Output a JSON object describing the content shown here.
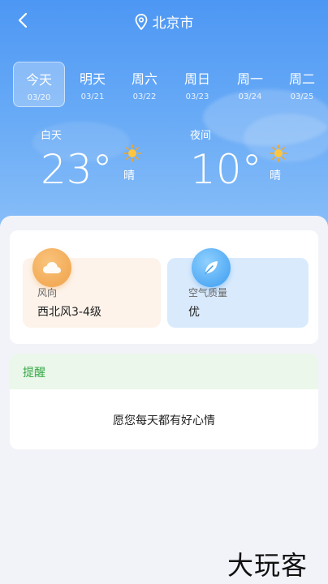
{
  "header": {
    "city": "北京市"
  },
  "days": [
    {
      "name": "今天",
      "date": "03/20"
    },
    {
      "name": "明天",
      "date": "03/21"
    },
    {
      "name": "周六",
      "date": "03/22"
    },
    {
      "name": "周日",
      "date": "03/23"
    },
    {
      "name": "周一",
      "date": "03/24"
    },
    {
      "name": "周二",
      "date": "03/25"
    }
  ],
  "selected_day_index": 0,
  "forecast": {
    "day": {
      "label": "白天",
      "temp": "23°",
      "condition": "晴",
      "icon": "sun-icon"
    },
    "night": {
      "label": "夜间",
      "temp": "10°",
      "condition": "晴",
      "icon": "sun-icon"
    }
  },
  "details": {
    "wind": {
      "label": "风向",
      "value": "西北风3-4级",
      "icon": "wind-cloud-icon"
    },
    "air": {
      "label": "空气质量",
      "value": "优",
      "icon": "leaf-icon"
    }
  },
  "reminder": {
    "title": "提醒",
    "message": "愿您每天都有好心情"
  },
  "watermark": "大玩客",
  "colors": {
    "accent": "#4d97f4",
    "reminder_green": "#35a845",
    "wind_orange": "#f0a24a",
    "air_blue": "#3b9cf0"
  }
}
